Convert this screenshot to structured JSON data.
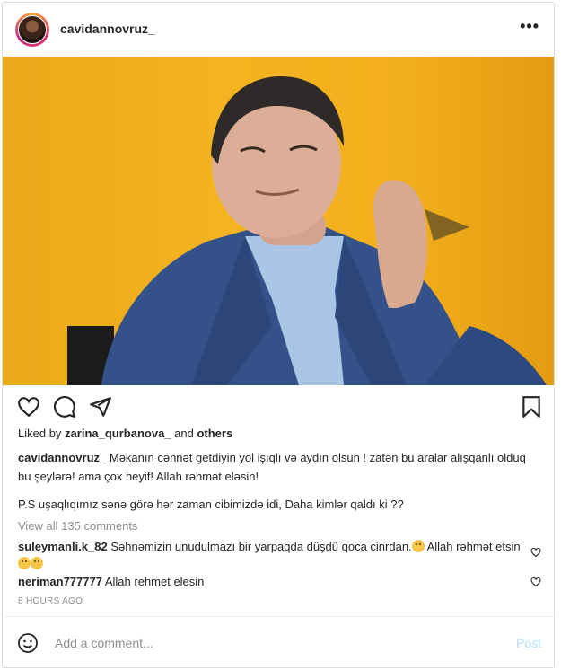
{
  "post": {
    "username": "cavidannovruz_",
    "more_label": "•••",
    "liked_prefix": "Liked by ",
    "liked_user": "zarina_qurbanova_",
    "liked_and": " and ",
    "liked_others": "others",
    "caption_user": "cavidannovruz_",
    "caption_text": " Məkanın cənnət getdiyin yol işıqlı və aydın olsun ! zatən bu aralar alışqanlı olduq bu şeylərə! ama çox heyif! Allah rəhmət eləsin!",
    "caption_ps": "P.S uşaqlıqımız sənə görə hər zaman cibimizdə idi, Daha kimlər qaldı ki ??",
    "view_all": "View all 135 comments",
    "comments": [
      {
        "user": "suleymanli.k_82",
        "text_a": " Səhnəmizin unudulmazı bir yarpaqda düşdü qoca cinrdan.",
        "text_b": " Allah rəhmət etsin"
      },
      {
        "user": "neriman777777",
        "text_a": " Allah rehmet elesin",
        "text_b": ""
      }
    ],
    "time": "8 HOURS AGO",
    "add_comment_placeholder": "Add a comment...",
    "post_button": "Post"
  },
  "icons": [
    "heart-icon",
    "comment-icon",
    "share-icon",
    "bookmark-icon",
    "emoji-icon"
  ],
  "colors": {
    "accent": "#0095f6",
    "post_disabled": "#b2dffc",
    "border": "#dbdbdb",
    "photo_bg": "#f3b01c"
  }
}
